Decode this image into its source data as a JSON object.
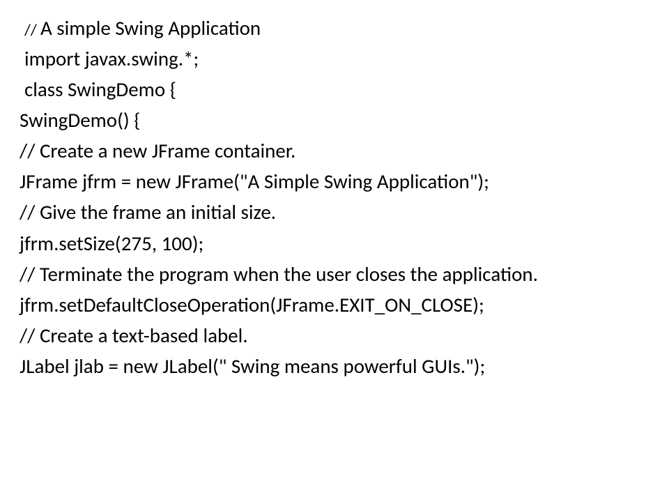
{
  "code": {
    "lines": [
      {
        "prefix": "// ",
        "text": "A simple Swing Application",
        "prefixSmall": true,
        "indent": true
      },
      {
        "prefix": "",
        "text": "import javax.swing.*;",
        "indent": true
      },
      {
        "prefix": "",
        "text": " class SwingDemo {",
        "indent": true
      },
      {
        "prefix": "",
        "text": "SwingDemo() {",
        "indent": false
      },
      {
        "prefix": "",
        "text": " // Create a new JFrame container.",
        "indent": false
      },
      {
        "prefix": "",
        "text": "JFrame jfrm = new JFrame(\"A Simple Swing Application\");",
        "indent": false
      },
      {
        "prefix": "",
        "text": " // Give the frame an initial size.",
        "indent": false
      },
      {
        "prefix": "",
        "text": "jfrm.setSize(275, 100);",
        "indent": false
      },
      {
        "prefix": "",
        "text": " // Terminate the program when the user closes the application.",
        "indent": false
      },
      {
        "prefix": "",
        "text": "jfrm.setDefaultCloseOperation(JFrame.EXIT_ON_CLOSE);",
        "indent": false
      },
      {
        "prefix": "",
        "text": " // Create a text-based label.",
        "indent": false
      },
      {
        "prefix": "",
        "text": "JLabel jlab = new JLabel(\" Swing means powerful GUIs.\");",
        "indent": false
      }
    ]
  }
}
